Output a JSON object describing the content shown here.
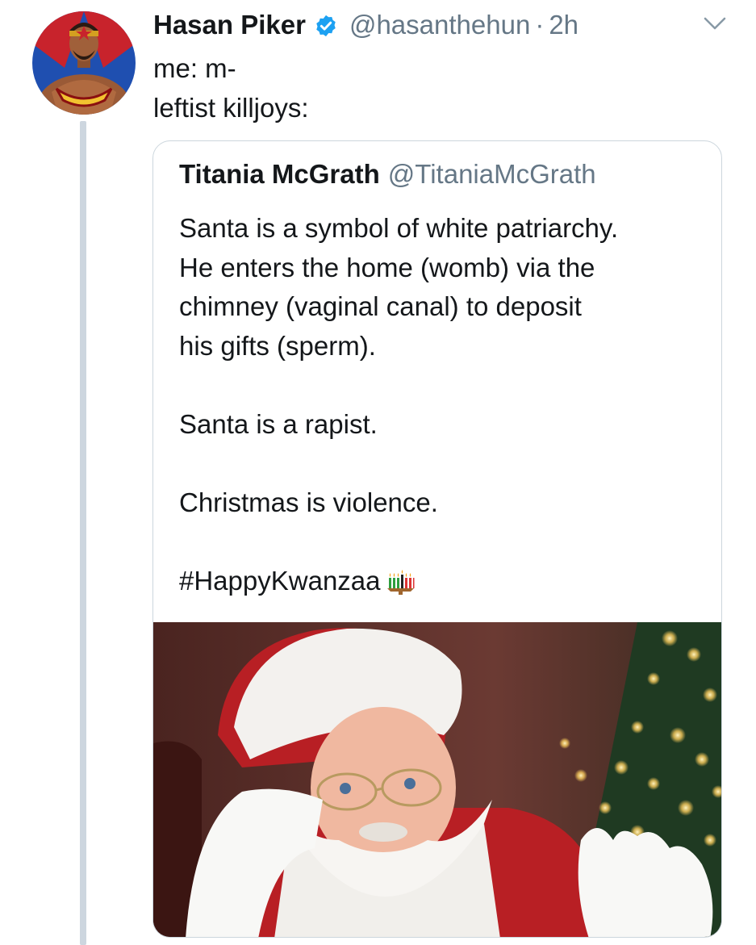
{
  "tweet": {
    "author_name": "Hasan Piker",
    "author_handle": "@hasanthehun",
    "separator": "·",
    "time": "2h",
    "verified_icon": "verified-badge-icon",
    "menu_icon": "chevron-down-icon",
    "text_lines": [
      "me: m-",
      "leftist killjoys:"
    ]
  },
  "quoted_tweet": {
    "author_name": "Titania McGrath",
    "author_handle": "@TitaniaMcGrath",
    "paragraph1": [
      "Santa is a symbol of white patriarchy.",
      "He enters the home (womb) via the",
      "chimney (vaginal canal) to deposit",
      "his gifts (sperm)."
    ],
    "paragraph2": "Santa is a rapist.",
    "paragraph3": "Christmas is violence.",
    "hashtag": "#HappyKwanzaa",
    "emoji_icon": "kinara-candles-icon"
  },
  "colors": {
    "text_primary": "#14171a",
    "text_secondary": "#657786",
    "verified_blue": "#1da1f2",
    "border": "#ccd6dd",
    "thread_line": "#cdd6df"
  }
}
